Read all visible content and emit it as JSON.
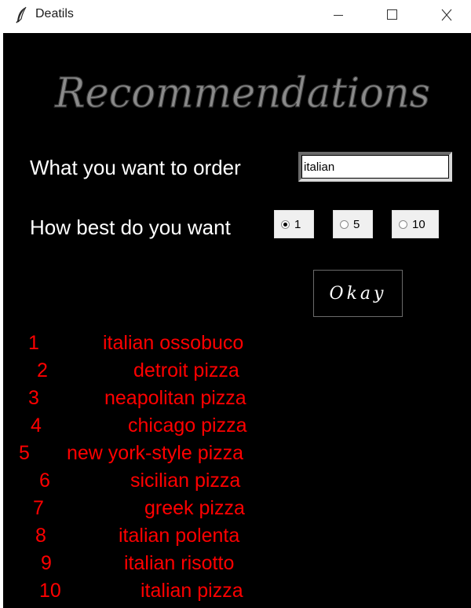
{
  "window": {
    "title": "Deatils",
    "icons": {
      "app": "feather-icon",
      "minimize": "minimize-icon",
      "maximize": "maximize-icon",
      "close": "close-icon"
    }
  },
  "form": {
    "heading": "Recommendations",
    "order_label": "What you want to order",
    "order_value": "italian",
    "best_label": "How best do you want",
    "options": [
      {
        "label": "1",
        "selected": true
      },
      {
        "label": "5",
        "selected": false
      },
      {
        "label": "10",
        "selected": false
      }
    ],
    "okay_label": "Okay"
  },
  "results": [
    {
      "rank": "1",
      "dish": "italian ossobuco"
    },
    {
      "rank": "2",
      "dish": "detroit pizza"
    },
    {
      "rank": "3",
      "dish": "neapolitan pizza"
    },
    {
      "rank": "4",
      "dish": "chicago pizza"
    },
    {
      "rank": "5",
      "dish": "new york-style pizza"
    },
    {
      "rank": "6",
      "dish": "sicilian pizza"
    },
    {
      "rank": "7",
      "dish": "greek pizza"
    },
    {
      "rank": "8",
      "dish": "italian polenta"
    },
    {
      "rank": "9",
      "dish": "italian risotto"
    },
    {
      "rank": "10",
      "dish": "italian pizza"
    }
  ],
  "colors": {
    "background": "#000000",
    "label_text": "#ffffff",
    "result_text": "#ff0000",
    "heading_fill": "#8a8a8a"
  }
}
